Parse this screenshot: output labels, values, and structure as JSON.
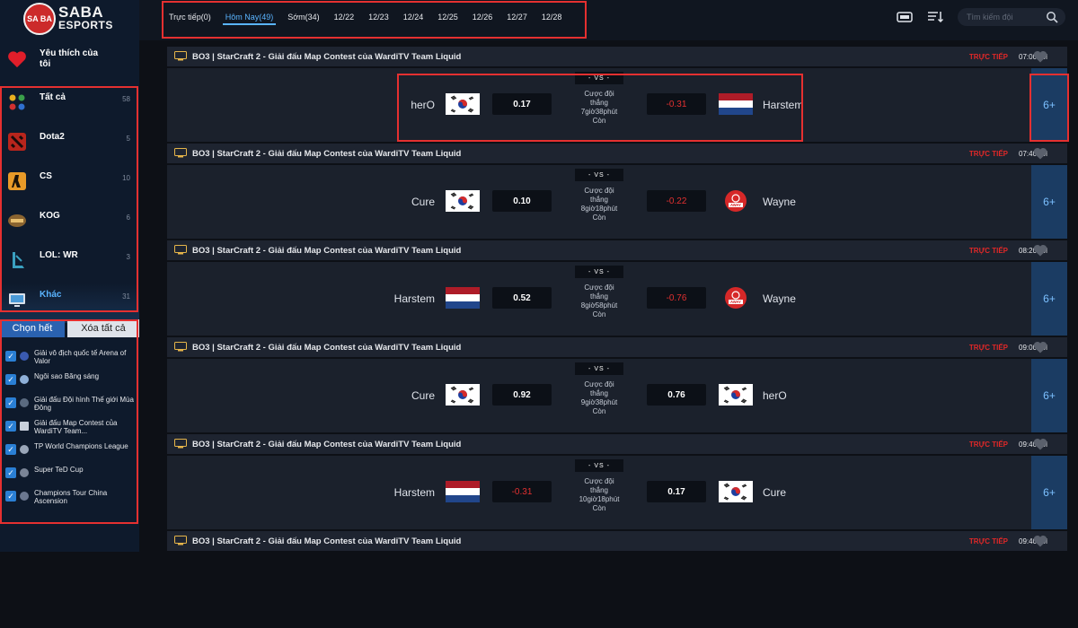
{
  "brand": {
    "circle": "SA BA",
    "line1": "SABA",
    "line2": "ESPORTS"
  },
  "favorite": {
    "label": "Yêu thích của tôi"
  },
  "games": [
    {
      "name": "Tất cả",
      "count": "58",
      "icon": "all-games-icon",
      "color": "#e0a020"
    },
    {
      "name": "Dota2",
      "count": "5",
      "icon": "dota2-icon",
      "color": "#c8281e"
    },
    {
      "name": "CS",
      "count": "10",
      "icon": "cs-icon",
      "color": "#e8a030"
    },
    {
      "name": "KOG",
      "count": "6",
      "icon": "kog-icon",
      "color": "#b08040"
    },
    {
      "name": "LOL: WR",
      "count": "3",
      "icon": "lol-wr-icon",
      "color": "#2a8aa8"
    },
    {
      "name": "Khác",
      "count": "31",
      "icon": "monitor-icon",
      "color": "#4a9ad8"
    }
  ],
  "selection": {
    "select_all": "Chọn hết",
    "clear_all": "Xóa tất cả"
  },
  "leagues": [
    {
      "name": "Giải vô địch quốc tế Arena of Valor"
    },
    {
      "name": "Ngôi sao Băng sáng"
    },
    {
      "name": "Giải đấu Đội hình Thế giới Mùa Đông"
    },
    {
      "name": "Giải đấu Map Contest của WardiTV Team..."
    },
    {
      "name": "TP World Champions League"
    },
    {
      "name": "Super TeD Cup"
    },
    {
      "name": "Champions Tour China Ascension"
    }
  ],
  "tabs": [
    {
      "label": "Trực tiếp(0)"
    },
    {
      "label": "Hôm Nay(49)"
    },
    {
      "label": "Sớm(34)"
    },
    {
      "label": "12/22"
    },
    {
      "label": "12/23"
    },
    {
      "label": "12/24"
    },
    {
      "label": "12/25"
    },
    {
      "label": "12/26"
    },
    {
      "label": "12/27"
    },
    {
      "label": "12/28"
    }
  ],
  "active_tab": 1,
  "search": {
    "placeholder": "Tìm kiếm đội"
  },
  "labels": {
    "live": "TRỰC TIẾP",
    "vs": "- VS -",
    "bet_line1": "Cược đội",
    "bet_line2": "thắng",
    "remaining": "Còn",
    "more": "6+"
  },
  "matches": [
    {
      "title": "BO3  |  StarCraft 2 - Giải đấu Map Contest của WardiTV Team Liquid",
      "time": "07:00PM",
      "team_left": "herO",
      "flag_left": "kr",
      "odd_left": "0.17",
      "team_right": "Harstem",
      "flag_right": "nl",
      "odd_right": "-0.31",
      "countdown": "7giờ38phút"
    },
    {
      "title": "BO3  |  StarCraft 2 - Giải đấu Map Contest của WardiTV Team Liquid",
      "time": "07:40PM",
      "team_left": "Cure",
      "flag_left": "kr",
      "odd_left": "0.10",
      "team_right": "Wayne",
      "flag_right": "away",
      "odd_right": "-0.22",
      "countdown": "8giờ18phút"
    },
    {
      "title": "BO3  |  StarCraft 2 - Giải đấu Map Contest của WardiTV Team Liquid",
      "time": "08:20PM",
      "team_left": "Harstem",
      "flag_left": "nl",
      "odd_left": "0.52",
      "team_right": "Wayne",
      "flag_right": "away",
      "odd_right": "-0.76",
      "countdown": "8giờ58phút"
    },
    {
      "title": "BO3  |  StarCraft 2 - Giải đấu Map Contest của WardiTV Team Liquid",
      "time": "09:00PM",
      "team_left": "Cure",
      "flag_left": "kr",
      "odd_left": "0.92",
      "team_right": "herO",
      "flag_right": "kr",
      "odd_right": "0.76",
      "countdown": "9giờ38phút"
    },
    {
      "title": "BO3  |  StarCraft 2 - Giải đấu Map Contest của WardiTV Team Liquid",
      "time": "09:40PM",
      "team_left": "Harstem",
      "flag_left": "nl",
      "odd_left": "-0.31",
      "team_right": "Cure",
      "flag_right": "kr",
      "odd_right": "0.17",
      "countdown": "10giờ18phút"
    },
    {
      "title": "BO3  |  StarCraft 2 - Giải đấu Map Contest của WardiTV Team Liquid",
      "time": "09:40PM"
    }
  ],
  "colors": {
    "live": "#e02828",
    "accent": "#5ab4ff",
    "negative": "#e23030",
    "highlight": "#e53030"
  }
}
